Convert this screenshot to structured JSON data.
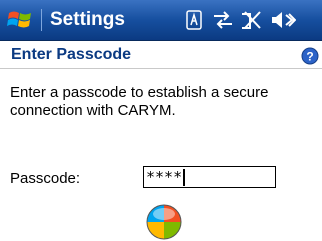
{
  "titlebar": {
    "title": "Settings",
    "icons": [
      "windows-start-icon",
      "sip-keyboard-icon",
      "connectivity-icon",
      "no-signal-icon",
      "volume-icon"
    ]
  },
  "page": {
    "title": "Enter Passcode",
    "help_icon": "help-icon"
  },
  "instructions": "Enter a passcode to establish a secure connection with CARYM.",
  "passcode": {
    "label": "Passcode:",
    "value": "****"
  },
  "status_orb_icon": "windows-orb-icon",
  "colors": {
    "title_bar": "#164f9f",
    "header_text": "#0b3a82"
  }
}
